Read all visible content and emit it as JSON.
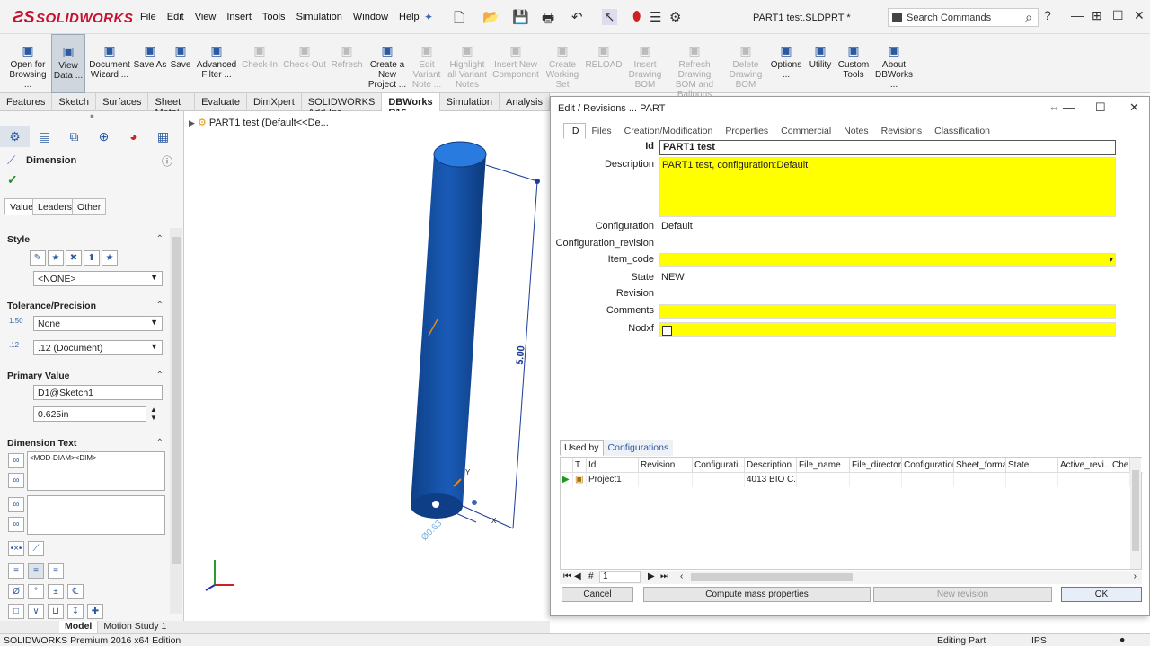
{
  "app": {
    "logo": "SOLIDWORKS",
    "menus": [
      "File",
      "Edit",
      "View",
      "Insert",
      "Tools",
      "Simulation",
      "Window",
      "Help"
    ],
    "document_title": "PART1 test.SLDPRT *",
    "search_placeholder": "Search Commands"
  },
  "commands": [
    {
      "label": "Open for Browsing ...",
      "icon": "open-browse-icon",
      "enabled": true
    },
    {
      "label": "View Data ...",
      "icon": "view-data-icon",
      "enabled": true,
      "active": true
    },
    {
      "label": "Document Wizard ...",
      "icon": "document-wizard-icon",
      "enabled": true
    },
    {
      "label": "Save As",
      "icon": "save-as-icon",
      "enabled": true
    },
    {
      "label": "Save",
      "icon": "save-icon",
      "enabled": true
    },
    {
      "label": "Advanced Filter ...",
      "icon": "filter-icon",
      "enabled": true
    },
    {
      "label": "Check-In",
      "icon": "check-in-icon",
      "enabled": false
    },
    {
      "label": "Check-Out",
      "icon": "check-out-icon",
      "enabled": false
    },
    {
      "label": "Refresh",
      "icon": "refresh-icon",
      "enabled": false
    },
    {
      "label": "Create a New Project ...",
      "icon": "new-project-icon",
      "enabled": true
    },
    {
      "label": "Edit Variant Note ...",
      "icon": "edit-variant-icon",
      "enabled": false
    },
    {
      "label": "Highlight all Variant Notes",
      "icon": "highlight-icon",
      "enabled": false
    },
    {
      "label": "Insert New Component",
      "icon": "insert-component-icon",
      "enabled": false
    },
    {
      "label": "Create Working Set",
      "icon": "working-set-icon",
      "enabled": false
    },
    {
      "label": "RELOAD",
      "icon": "reload-icon",
      "enabled": false
    },
    {
      "label": "Insert Drawing BOM",
      "icon": "insert-bom-icon",
      "enabled": false
    },
    {
      "label": "Refresh Drawing BOM and Balloons",
      "icon": "refresh-bom-icon",
      "enabled": false
    },
    {
      "label": "Delete Drawing BOM",
      "icon": "delete-bom-icon",
      "enabled": false
    },
    {
      "label": "Options ...",
      "icon": "options-icon",
      "enabled": true
    },
    {
      "label": "Utility",
      "icon": "utility-icon",
      "enabled": true
    },
    {
      "label": "Custom Tools",
      "icon": "custom-tools-icon",
      "enabled": true
    },
    {
      "label": "About DBWorks ...",
      "icon": "about-icon",
      "enabled": true
    }
  ],
  "feature_tabs": [
    "Features",
    "Sketch",
    "Surfaces",
    "Sheet Metal",
    "Evaluate",
    "DimXpert",
    "SOLIDWORKS Add-Ins",
    "DBWorks R16",
    "Simulation",
    "Analysis"
  ],
  "property_manager": {
    "title": "Dimension",
    "tabs": [
      "Value",
      "Leaders",
      "Other"
    ],
    "style_label": "Style",
    "style_value": "<NONE>",
    "tolerance_label": "Tolerance/Precision",
    "tolerance_value": "None",
    "precision_value": ".12 (Document)",
    "primary_label": "Primary Value",
    "primary_name": "D1@Sketch1",
    "primary_value": "0.625in",
    "dimtext_label": "Dimension Text",
    "dimtext_value": "<MOD-DIAM><DIM>"
  },
  "bottom_tabs": [
    "Model",
    "Motion Study 1"
  ],
  "status": {
    "edition": "SOLIDWORKS Premium 2016 x64 Edition",
    "mode": "Editing Part",
    "units": "IPS"
  },
  "viewport": {
    "tree_item": "PART1 test  (Default<<De...",
    "dim_length": "5.00",
    "dim_diameter": "Ø0.63",
    "axis_y": "Y",
    "axis_x": "X"
  },
  "dialog": {
    "title": "Edit / Revisions ... PART",
    "tabs": [
      "ID",
      "Files",
      "Creation/Modification",
      "Properties",
      "Commercial",
      "Notes",
      "Revisions",
      "Classification"
    ],
    "fields": {
      "id_label": "Id",
      "id_value": "PART1 test",
      "description_label": "Description",
      "description_value": "PART1 test, configuration:Default",
      "configuration_label": "Configuration",
      "configuration_value": "Default",
      "config_rev_label": "Configuration_revision",
      "item_code_label": "Item_code",
      "state_label": "State",
      "state_value": "NEW",
      "revision_label": "Revision",
      "comments_label": "Comments",
      "nodxf_label": "Nodxf"
    },
    "lower_tabs": [
      "Used by",
      "Configurations"
    ],
    "grid_headers": [
      "T",
      "Id",
      "Revision",
      "Configurati...",
      "Description",
      "File_name",
      "File_directory",
      "Configuration",
      "Sheet_format",
      "State",
      "Active_revi...",
      "Che"
    ],
    "grid_rows": [
      {
        "id": "Project1",
        "revision": "",
        "configuration": "",
        "description": "4013 BIO C...",
        "file_name": "",
        "file_directory": "",
        "configuration2": "",
        "sheet_format": "",
        "state": "",
        "active_rev": "",
        "che": ""
      }
    ],
    "pager_value": "1",
    "pager_hash": "#",
    "buttons": {
      "cancel": "Cancel",
      "compute": "Compute mass properties",
      "new_revision": "New revision",
      "ok": "OK"
    }
  }
}
